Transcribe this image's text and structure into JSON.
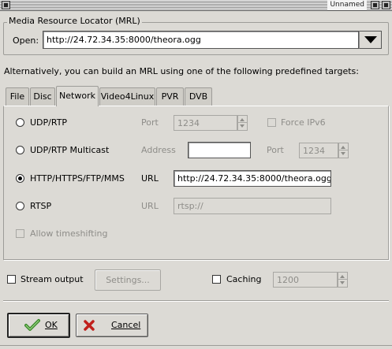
{
  "window": {
    "title": "Unnamed"
  },
  "mrl": {
    "frame_label": "Media Resource Locator (MRL)",
    "open_label": "Open:",
    "open_value": "http://24.72.34.35:8000/theora.ogg"
  },
  "hint_text": "Alternatively, you can build an MRL using one of the following predefined targets:",
  "tabs": [
    {
      "label": "File"
    },
    {
      "label": "Disc"
    },
    {
      "label": "Network"
    },
    {
      "label": "Video4Linux"
    },
    {
      "label": "PVR"
    },
    {
      "label": "DVB"
    }
  ],
  "active_tab": "Network",
  "network": {
    "udp_rtp": {
      "label": "UDP/RTP",
      "port_label": "Port",
      "port_value": "1234",
      "force_ipv6_label": "Force IPv6"
    },
    "udp_multicast": {
      "label": "UDP/RTP Multicast",
      "address_label": "Address",
      "address_value": "",
      "port_label": "Port",
      "port_value": "1234"
    },
    "http": {
      "label": "HTTP/HTTPS/FTP/MMS",
      "url_label": "URL",
      "url_value": "http://24.72.34.35:8000/theora.ogg"
    },
    "rtsp": {
      "label": "RTSP",
      "url_label": "URL",
      "url_value": "rtsp://"
    },
    "allow_timeshifting_label": "Allow timeshifting",
    "selected": "http"
  },
  "stream_output": {
    "label": "Stream output",
    "settings_label": "Settings..."
  },
  "caching": {
    "label": "Caching",
    "value": "1200"
  },
  "buttons": {
    "ok_label": "OK",
    "cancel_label": "Cancel"
  },
  "colors": {
    "background": "#dcdad5",
    "ok_icon": "#3b8a2a",
    "cancel_icon": "#c0201c"
  },
  "icons": {
    "ok": "check-icon",
    "cancel": "cross-icon"
  }
}
